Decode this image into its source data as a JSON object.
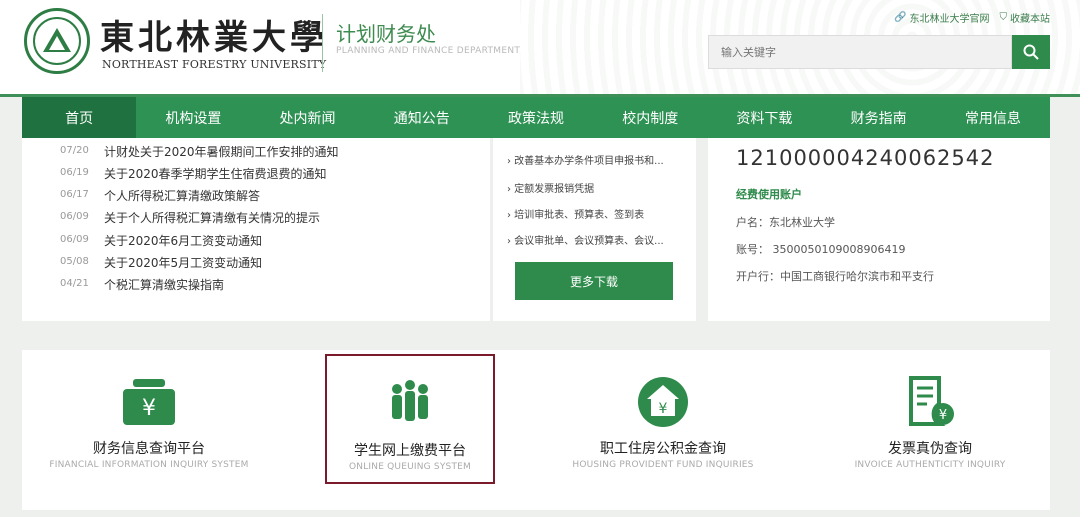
{
  "header": {
    "university_cn": "東北林業大學",
    "university_en": "NORTHEAST FORESTRY UNIVERSITY",
    "dept_cn": "计划财务处",
    "dept_en": "PLANNING AND FINANCE DEPARTMENT",
    "links": {
      "official": "东北林业大学官网",
      "bookmark": "收藏本站"
    },
    "search_placeholder": "输入关键字"
  },
  "nav": [
    "首页",
    "机构设置",
    "处内新闻",
    "通知公告",
    "政策法规",
    "校内制度",
    "资料下载",
    "财务指南",
    "常用信息"
  ],
  "news": [
    {
      "date": "07/20",
      "title": "计财处关于2020年暑假期间工作安排的通知"
    },
    {
      "date": "06/19",
      "title": "关于2020春季学期学生住宿费退费的通知"
    },
    {
      "date": "06/17",
      "title": "个人所得税汇算清缴政策解答"
    },
    {
      "date": "06/09",
      "title": "关于个人所得税汇算清缴有关情况的提示"
    },
    {
      "date": "06/09",
      "title": "关于2020年6月工资变动通知"
    },
    {
      "date": "05/08",
      "title": "关于2020年5月工资变动通知"
    },
    {
      "date": "04/21",
      "title": "个税汇算清缴实操指南"
    }
  ],
  "downloads": {
    "items": [
      "› 改善基本办学条件项目申报书和...",
      "› 定额发票报销凭据",
      "› 培训审批表、预算表、签到表",
      "› 会议审批单、会议预算表、会议..."
    ],
    "more": "更多下载"
  },
  "account": {
    "number": "121000004240062542",
    "title": "经费使用账户",
    "holder": "户名：东北林业大学",
    "acct": "账号：  3500050109008906419",
    "bank": "开户行：中国工商银行哈尔滨市和平支行"
  },
  "services": [
    {
      "cn": "财务信息查询平台",
      "en": "FINANCIAL INFORMATION INQUIRY SYSTEM",
      "icon": "wallet-yen-icon"
    },
    {
      "cn": "学生网上缴费平台",
      "en": "ONLINE QUEUING SYSTEM",
      "icon": "people-group-icon"
    },
    {
      "cn": "职工住房公积金查询",
      "en": "HOUSING PROVIDENT FUND INQUIRIES",
      "icon": "house-yen-icon"
    },
    {
      "cn": "发票真伪查询",
      "en": "INVOICE AUTHENTICITY INQUIRY",
      "icon": "invoice-yen-icon"
    }
  ],
  "colors": {
    "primary": "#2f9255",
    "dark": "#1f7240",
    "highlight_border": "#7a1a2a"
  }
}
